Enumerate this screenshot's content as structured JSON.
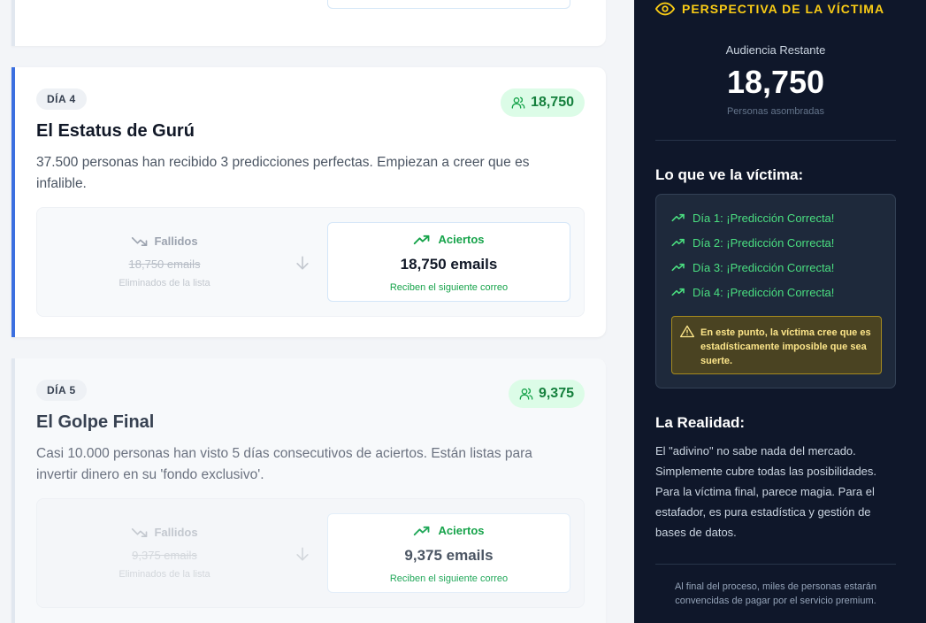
{
  "cards": [
    {
      "day": "DÍA 4",
      "count": "18,750",
      "title": "El Estatus de Gurú",
      "description": "37.500 personas han recibido 3 predicciones perfectas. Empiezan a creer que es infalible.",
      "fail_label": "Fallidos",
      "fail_count": "18,750 emails",
      "fail_note": "Eliminados de la lista",
      "hit_label": "Aciertos",
      "hit_count": "18,750 emails",
      "hit_note": "Reciben el siguiente correo"
    },
    {
      "day": "DÍA 5",
      "count": "9,375",
      "title": "El Golpe Final",
      "description": "Casi 10.000 personas han visto 5 días consecutivos de aciertos. Están listas para invertir dinero en su 'fondo exclusivo'.",
      "fail_label": "Fallidos",
      "fail_count": "9,375 emails",
      "fail_note": "Eliminados de la lista",
      "hit_label": "Aciertos",
      "hit_count": "9,375 emails",
      "hit_note": "Reciben el siguiente correo"
    }
  ],
  "panel": {
    "header": "PERSPECTIVA DE LA VÍCTIMA",
    "audience_label": "Audiencia Restante",
    "audience_value": "18,750",
    "audience_sub": "Personas asombradas",
    "victim_title": "Lo que ve la víctima:",
    "victim_items": [
      "Día 1: ¡Predicción Correcta!",
      "Día 2: ¡Predicción Correcta!",
      "Día 3: ¡Predicción Correcta!",
      "Día 4: ¡Predicción Correcta!"
    ],
    "warning": "En este punto, la víctima cree que es estadísticamente imposible que sea suerte.",
    "reality_title": "La Realidad:",
    "reality_text": "El \"adivino\" no sabe nada del mercado. Simplemente cubre todas las posibilidades. Para la víctima final, parece magia. Para el estafador, es pura estadística y gestión de bases de datos.",
    "footer": "Al final del proceso, miles de personas estarán convencidas de pagar por el servicio premium."
  },
  "colors": {
    "accent_blue": "#3b6fe0",
    "success_green": "#16a34a",
    "panel_bg": "#0f172a",
    "warning_yellow": "#facc15"
  }
}
